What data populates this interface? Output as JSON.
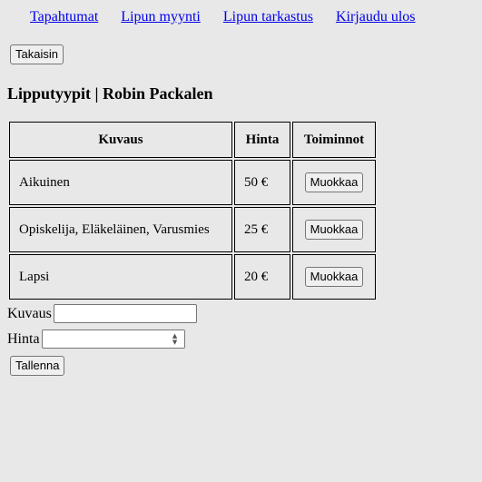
{
  "nav": {
    "links": [
      {
        "label": "Tapahtumat"
      },
      {
        "label": "Lipun myynti"
      },
      {
        "label": "Lipun tarkastus"
      },
      {
        "label": "Kirjaudu ulos"
      }
    ]
  },
  "back_button": "Takaisin",
  "page_title": "Lipputyypit | Robin Packalen",
  "table": {
    "headers": [
      "Kuvaus",
      "Hinta",
      "Toiminnot"
    ],
    "rows": [
      {
        "description": "Aikuinen",
        "price": "50 €",
        "action": "Muokkaa"
      },
      {
        "description": "Opiskelija, Eläkeläinen, Varusmies",
        "price": "25 €",
        "action": "Muokkaa"
      },
      {
        "description": "Lapsi",
        "price": "20 €",
        "action": "Muokkaa"
      }
    ]
  },
  "form": {
    "description_label": "Kuvaus",
    "description_value": "",
    "price_label": "Hinta",
    "price_value": "",
    "save_label": "Tallenna"
  }
}
